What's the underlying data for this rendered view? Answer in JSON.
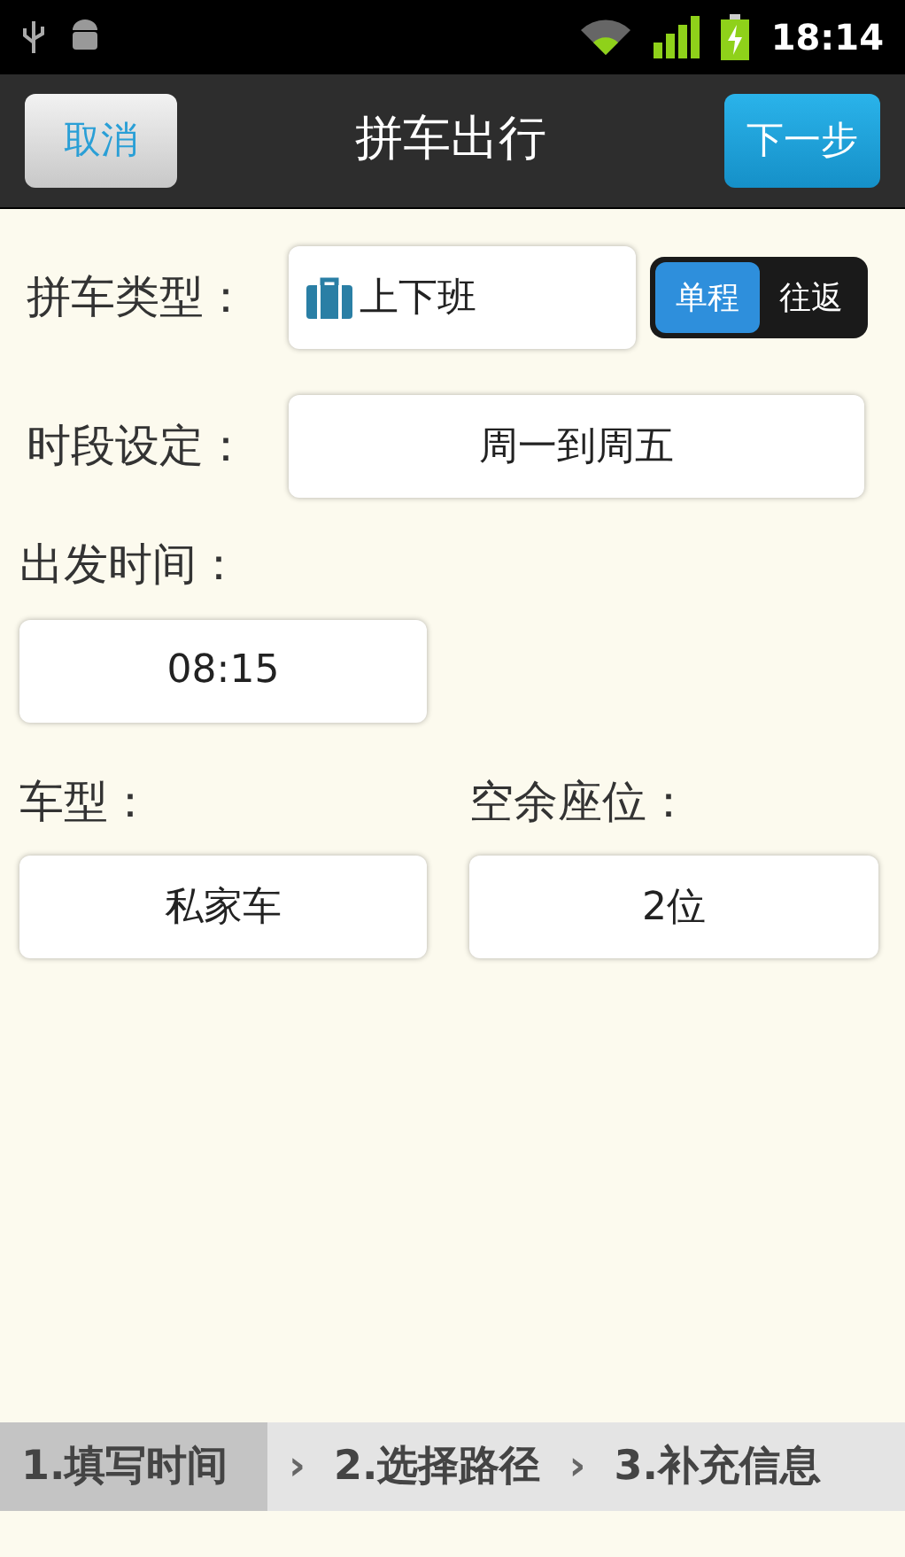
{
  "status_bar": {
    "time": "18:14"
  },
  "toolbar": {
    "cancel": "取消",
    "title": "拼车出行",
    "next": "下一步"
  },
  "trip_type": {
    "label": "拼车类型：",
    "value": "上下班",
    "options": [
      {
        "label": "单程",
        "selected": true
      },
      {
        "label": "往返",
        "selected": false
      }
    ]
  },
  "period": {
    "label": "时段设定：",
    "value": "周一到周五"
  },
  "departure": {
    "label": "出发时间：",
    "value": "08:15"
  },
  "vehicle": {
    "label": "车型：",
    "value": "私家车"
  },
  "seats": {
    "label": "空余座位：",
    "value": "2位"
  },
  "steps": [
    {
      "label": "1.填写时间",
      "selected": true
    },
    {
      "label": "2.选择路径",
      "selected": false
    },
    {
      "label": "3.补充信息",
      "selected": false
    }
  ],
  "separators": [
    "›",
    "›"
  ]
}
